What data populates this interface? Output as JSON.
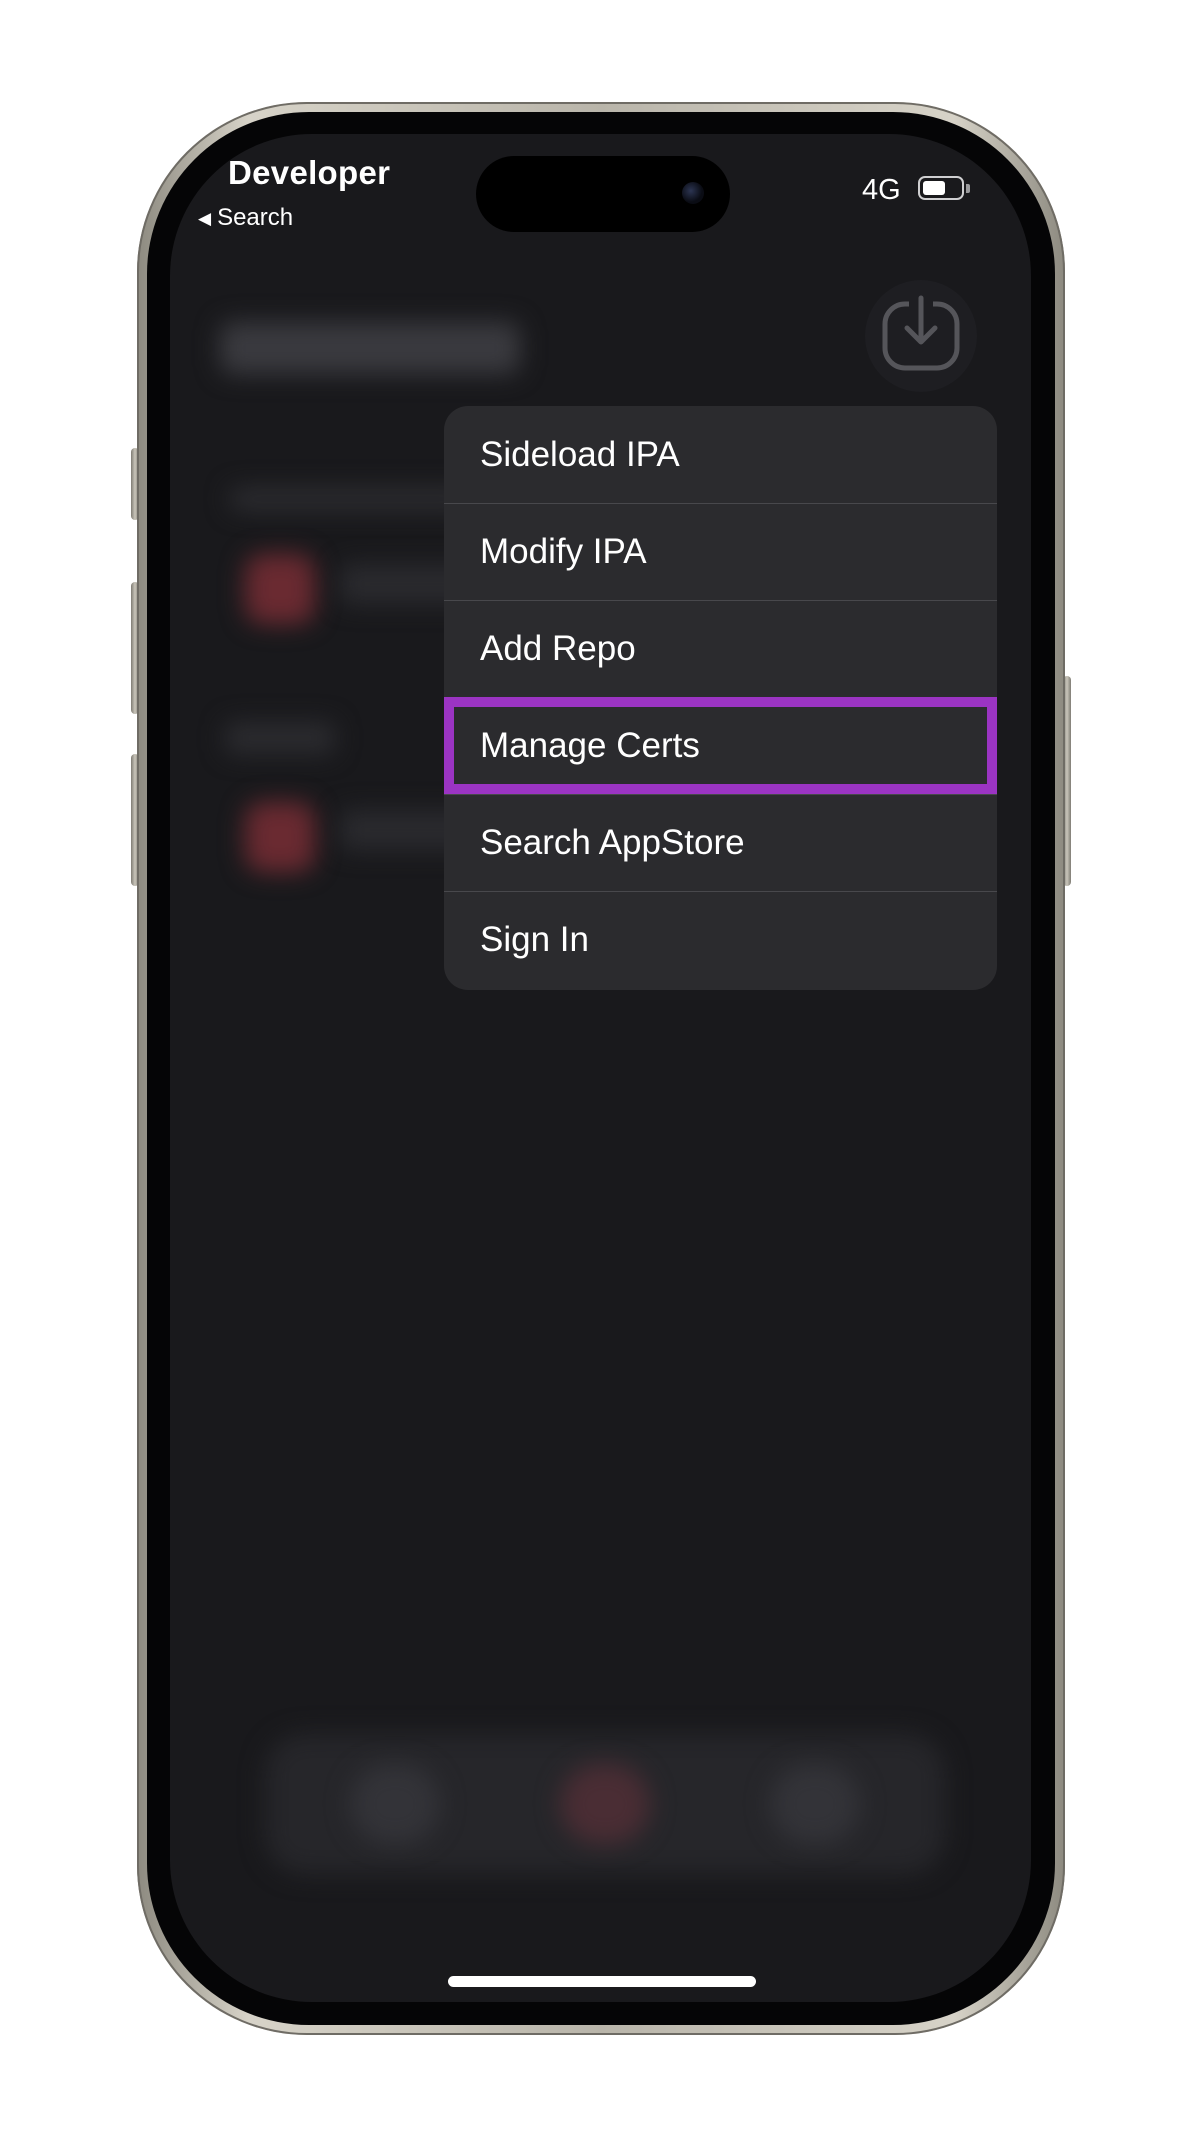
{
  "status_bar": {
    "title": "Developer",
    "back_label": "Search",
    "network": "4G",
    "battery_level": 0.6
  },
  "download_button": {
    "icon": "download-tray-icon"
  },
  "menu": {
    "items": [
      {
        "label": "Sideload IPA",
        "highlighted": false
      },
      {
        "label": "Modify IPA",
        "highlighted": false
      },
      {
        "label": "Add Repo",
        "highlighted": false
      },
      {
        "label": "Manage Certs",
        "highlighted": true
      },
      {
        "label": "Search AppStore",
        "highlighted": false
      },
      {
        "label": "Sign In",
        "highlighted": false
      }
    ]
  },
  "colors": {
    "highlight": "#9b34c3",
    "menu_background": "#2b2b2e",
    "screen_background": "#19191c"
  }
}
